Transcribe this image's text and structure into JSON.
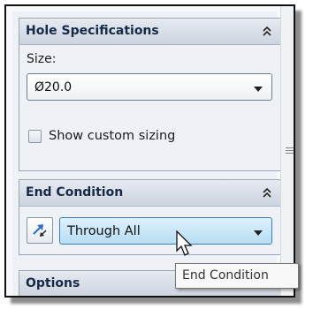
{
  "hole_specifications": {
    "title": "Hole Specifications",
    "size_label": "Size:",
    "size_value": "Ø20.0",
    "custom_sizing_label": "Show custom sizing",
    "custom_sizing_checked": false
  },
  "end_condition": {
    "title": "End Condition",
    "value": "Through All",
    "flip_icon": "reverse-direction-icon"
  },
  "options": {
    "title": "Options"
  },
  "tooltip": {
    "text": "End Condition"
  },
  "colors": {
    "header_text": "#162a48",
    "selected_combo": "#bfe3f8",
    "panel_bg": "#eef1f6"
  }
}
